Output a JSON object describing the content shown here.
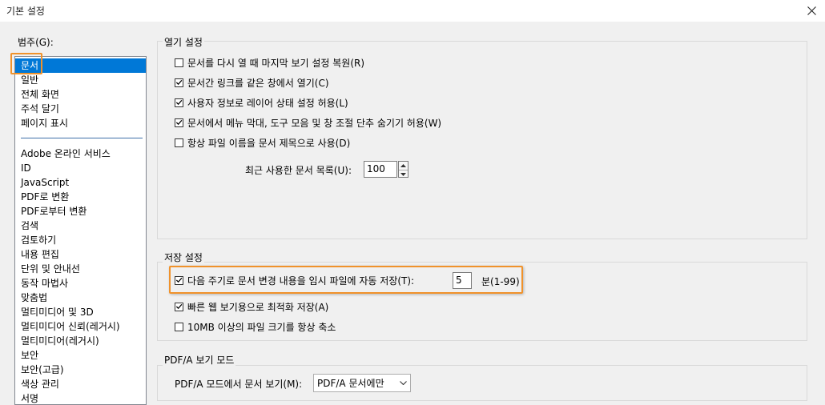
{
  "window": {
    "title": "기본 설정"
  },
  "sidebar": {
    "label": "범주(G):",
    "top_items": [
      "문서",
      "일반",
      "전체 화면",
      "주석 달기",
      "페이지 표시"
    ],
    "items": [
      "Adobe 온라인 서비스",
      "ID",
      "JavaScript",
      "PDF로 변환",
      "PDF로부터 변환",
      "검색",
      "검토하기",
      "내용 편집",
      "단위 및 안내선",
      "동작 마법사",
      "맞춤법",
      "멀티미디어 및 3D",
      "멀티미디어 신뢰(레거시)",
      "멀티미디어(레거시)",
      "보안",
      "보안(고급)",
      "색상 관리",
      "서명"
    ]
  },
  "open_settings": {
    "title": "열기 설정",
    "options": [
      {
        "label": "문서를 다시 열 때 마지막 보기 설정 복원(R)",
        "checked": false
      },
      {
        "label": "문서간 링크를 같은 창에서 열기(C)",
        "checked": true
      },
      {
        "label": "사용자 정보로 레이어 상태 설정 허용(L)",
        "checked": true
      },
      {
        "label": "문서에서 메뉴 막대, 도구 모음 및 창 조절 단추 숨기기 허용(W)",
        "checked": true
      },
      {
        "label": "항상 파일 이름을 문서 제목으로 사용(D)",
        "checked": false
      }
    ],
    "recent_label": "최근 사용한 문서 목록(U):",
    "recent_value": "100"
  },
  "save_settings": {
    "title": "저장 설정",
    "autosave_label": "다음 주기로 문서 변경 내용을 임시 파일에 자동 저장(T):",
    "autosave_checked": true,
    "autosave_value": "5",
    "autosave_unit": "분(1-99)",
    "fast_web_label": "빠른 웹 보기용으로 최적화 저장(A)",
    "fast_web_checked": true,
    "shrink_label": "10MB 이상의 파일 크기를 항상 축소",
    "shrink_checked": false
  },
  "pdfa": {
    "title": "PDF/A 보기 모드",
    "mode_label": "PDF/A 모드에서 문서 보기(M):",
    "mode_value": "PDF/A 문서에만"
  },
  "colors": {
    "highlight": "#f0922b",
    "selection": "#0078d7"
  }
}
